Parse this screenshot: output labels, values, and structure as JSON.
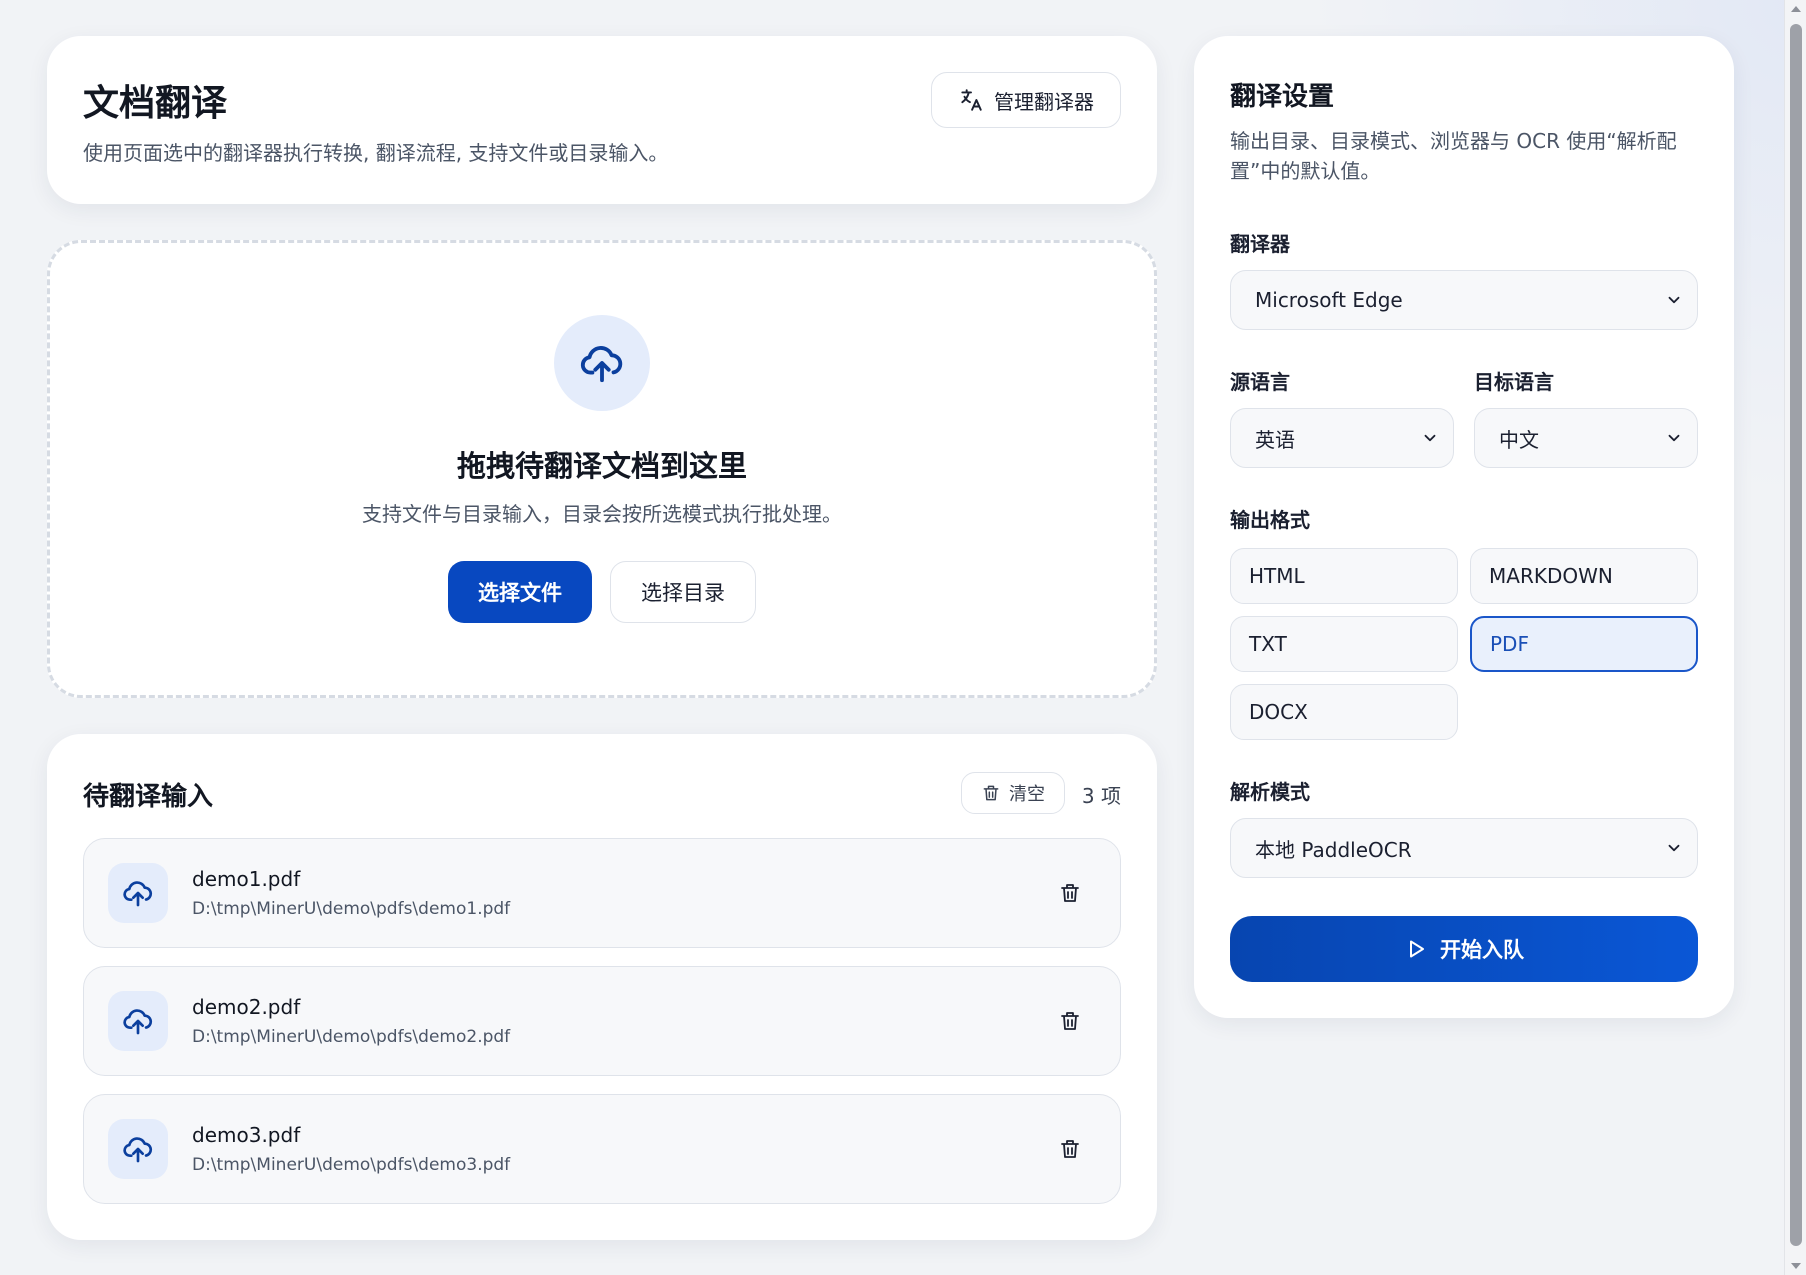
{
  "header": {
    "title": "文档翻译",
    "subtitle": "使用页面选中的翻译器执行转换, 翻译流程, 支持文件或目录输入。",
    "manage_button": "管理翻译器",
    "manage_icon": "translate-icon"
  },
  "upload": {
    "icon": "cloud-upload-icon",
    "title": "拖拽待翻译文档到这里",
    "description": "支持文件与目录输入，目录会按所选模式执行批处理。",
    "select_file": "选择文件",
    "select_dir": "选择目录"
  },
  "queue": {
    "title": "待翻译输入",
    "clear_button": "清空",
    "count": "3 项",
    "items": [
      {
        "name": "demo1.pdf",
        "path": "D:\\tmp\\MinerU\\demo\\pdfs\\demo1.pdf"
      },
      {
        "name": "demo2.pdf",
        "path": "D:\\tmp\\MinerU\\demo\\pdfs\\demo2.pdf"
      },
      {
        "name": "demo3.pdf",
        "path": "D:\\tmp\\MinerU\\demo\\pdfs\\demo3.pdf"
      }
    ]
  },
  "settings": {
    "title": "翻译设置",
    "description": "输出目录、目录模式、浏览器与 OCR 使用“解析配置”中的默认值。",
    "translator_label": "翻译器",
    "translator_value": "Microsoft Edge",
    "source_lang_label": "源语言",
    "source_lang_value": "英语",
    "target_lang_label": "目标语言",
    "target_lang_value": "中文",
    "output_format_label": "输出格式",
    "formats": [
      "HTML",
      "MARKDOWN",
      "TXT",
      "PDF",
      "DOCX"
    ],
    "selected_format": "PDF",
    "parse_mode_label": "解析模式",
    "parse_mode_value": "本地 PaddleOCR",
    "start_button": "开始入队"
  },
  "colors": {
    "primary": "#0848c0",
    "accent_bg": "#e4ecfb",
    "selected_border": "#1a56c9"
  }
}
